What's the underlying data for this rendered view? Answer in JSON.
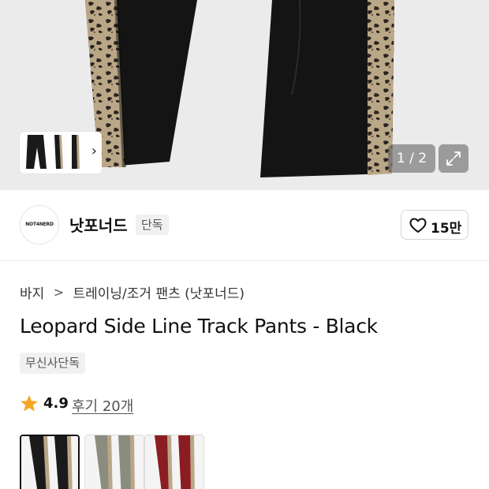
{
  "gallery": {
    "counter_text": "1 / 2",
    "thumb_chevron": "›",
    "expand_icon": "expand-arrows-icon"
  },
  "brand": {
    "logo_text": "NOT4NERD",
    "name": "낫포너드",
    "tag": "단독",
    "like_icon": "heart-outline-icon",
    "like_count": "15만"
  },
  "breadcrumb": {
    "items": [
      "바지",
      "트레이닝/조거 팬츠 (낫포너드)"
    ],
    "separator": ">"
  },
  "product": {
    "title": "Leopard Side Line Track Pants - Black",
    "badge": "무신사단독",
    "rating": "4.9",
    "reviews": "후기 20개"
  },
  "colors": {
    "star": "#f5a623",
    "options": [
      "#1a1a1a",
      "#8a8d7e",
      "#8b1d22"
    ]
  }
}
